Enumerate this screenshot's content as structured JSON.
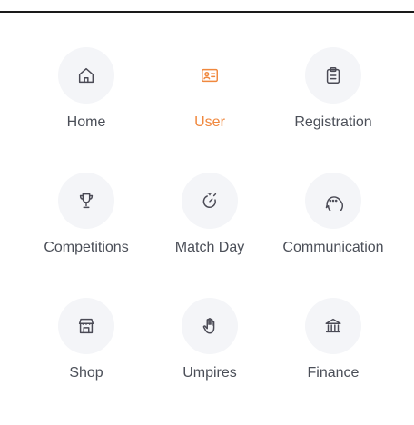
{
  "menu": {
    "items": [
      {
        "label": "Home",
        "icon": "home-icon",
        "active": false
      },
      {
        "label": "User",
        "icon": "user-card-icon",
        "active": true
      },
      {
        "label": "Registration",
        "icon": "clipboard-icon",
        "active": false
      },
      {
        "label": "Competitions",
        "icon": "trophy-icon",
        "active": false
      },
      {
        "label": "Match Day",
        "icon": "stopwatch-icon",
        "active": false
      },
      {
        "label": "Communication",
        "icon": "chat-bubble-icon",
        "active": false
      },
      {
        "label": "Shop",
        "icon": "store-icon",
        "active": false
      },
      {
        "label": "Umpires",
        "icon": "hand-icon",
        "active": false
      },
      {
        "label": "Finance",
        "icon": "bank-icon",
        "active": false
      }
    ]
  },
  "colors": {
    "accent": "#f0883e",
    "text": "#4b4f58",
    "icon_bg": "#f4f5f8"
  }
}
